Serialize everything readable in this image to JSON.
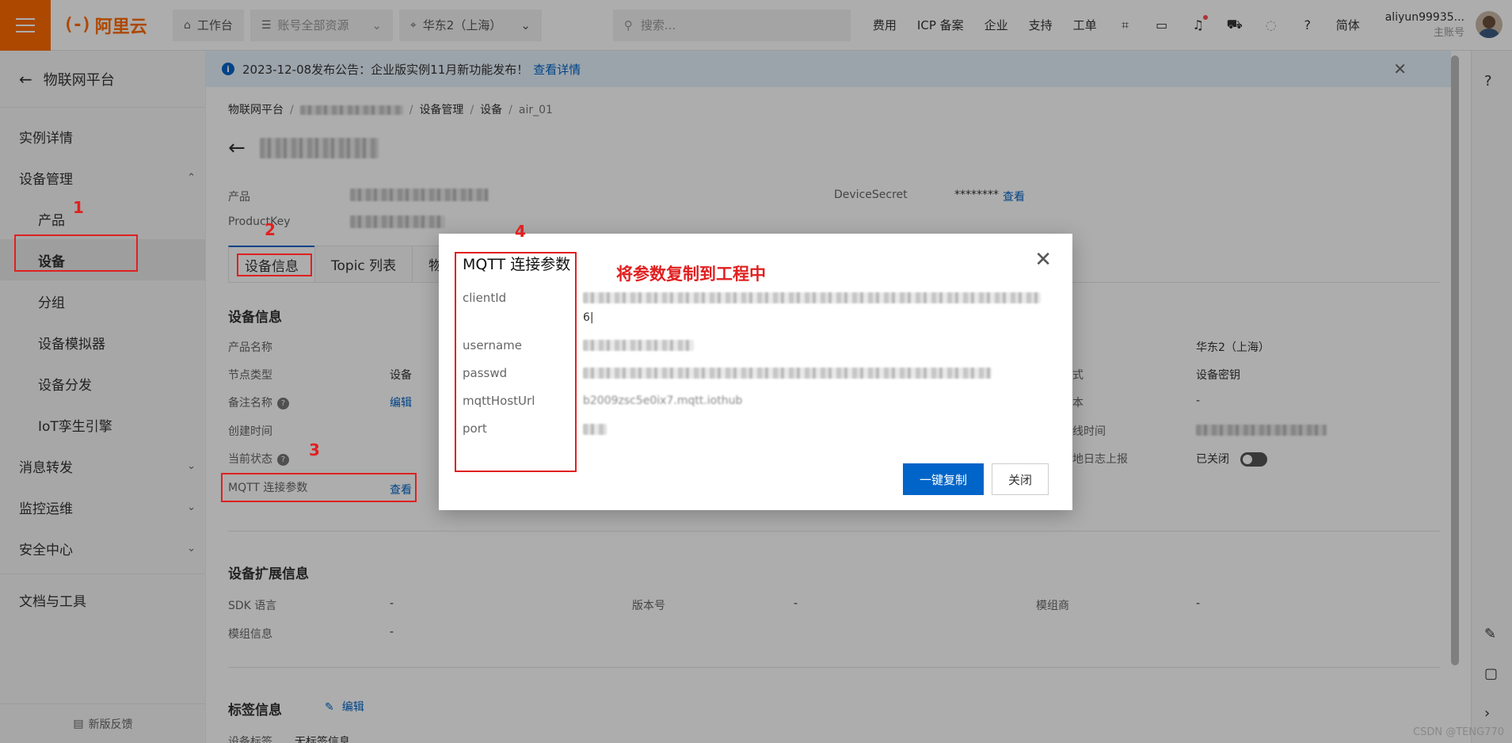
{
  "topbar": {
    "logo_text": "阿里云",
    "workbench": "工作台",
    "resources": "账号全部资源",
    "region": "华东2（上海）",
    "search_placeholder": "搜索...",
    "links": [
      "费用",
      "ICP 备案",
      "企业",
      "支持",
      "工单"
    ],
    "lang": "简体",
    "user_name": "aliyun99935...",
    "user_role": "主账号"
  },
  "sidebar": {
    "back_label": "物联网平台",
    "items": [
      {
        "label": "实例详情"
      },
      {
        "label": "设备管理"
      },
      {
        "label": "产品"
      },
      {
        "label": "设备"
      },
      {
        "label": "分组"
      },
      {
        "label": "设备模拟器"
      },
      {
        "label": "设备分发"
      },
      {
        "label": "IoT孪生引擎"
      },
      {
        "label": "消息转发"
      },
      {
        "label": "监控运维"
      },
      {
        "label": "安全中心"
      },
      {
        "label": "文档与工具"
      }
    ],
    "feedback": "新版反馈"
  },
  "notice": {
    "text": "2023-12-08发布公告：企业版实例11月新功能发布！",
    "link": "查看详情"
  },
  "breadcrumb": {
    "items": [
      "物联网平台",
      "设备管理",
      "设备",
      "air_01"
    ]
  },
  "device": {
    "product_label": "产品",
    "productkey_label": "ProductKey",
    "secret_label": "DeviceSecret",
    "secret_value": "********",
    "secret_link": "查看"
  },
  "tabs": [
    "设备信息",
    "Topic 列表",
    "物"
  ],
  "device_info": {
    "title": "设备信息",
    "labels": [
      "产品名称",
      "节点类型",
      "备注名称",
      "创建时间",
      "当前状态",
      "MQTT 连接参数"
    ],
    "node_type": "设备",
    "remark_link": "编辑",
    "mqtt_link": "查看",
    "region_value": "华东2（上海）",
    "auth_value": "设备密钥",
    "dash": "-",
    "right_label_1": "式",
    "right_label_2": "本",
    "right_label_3": "线时间",
    "right_label_4": "地日志上报",
    "log_status": "已关闭"
  },
  "ext_info": {
    "title": "设备扩展信息",
    "sdk_label": "SDK 语言",
    "version_label": "版本号",
    "vendor_label": "模组商",
    "module_label": "模组信息",
    "dash": "-"
  },
  "tag_info": {
    "title": "标签信息",
    "edit": "编辑",
    "tag_label": "设备标签",
    "tag_value": "无标签信息"
  },
  "modal": {
    "title": "MQTT 连接参数",
    "fields": [
      {
        "label": "clientId",
        "value_tail": "6|"
      },
      {
        "label": "username"
      },
      {
        "label": "passwd"
      },
      {
        "label": "mqttHostUrl",
        "value_fragment": "b2009zsc5e0ix7.mqtt.iothub"
      },
      {
        "label": "port"
      }
    ],
    "copy_button": "一键复制",
    "close_button": "关闭"
  },
  "annotations": {
    "n1": "1",
    "n2": "2",
    "n3": "3",
    "n4": "4",
    "hint": "将参数复制到工程中"
  },
  "watermark": "CSDN @TENG770"
}
